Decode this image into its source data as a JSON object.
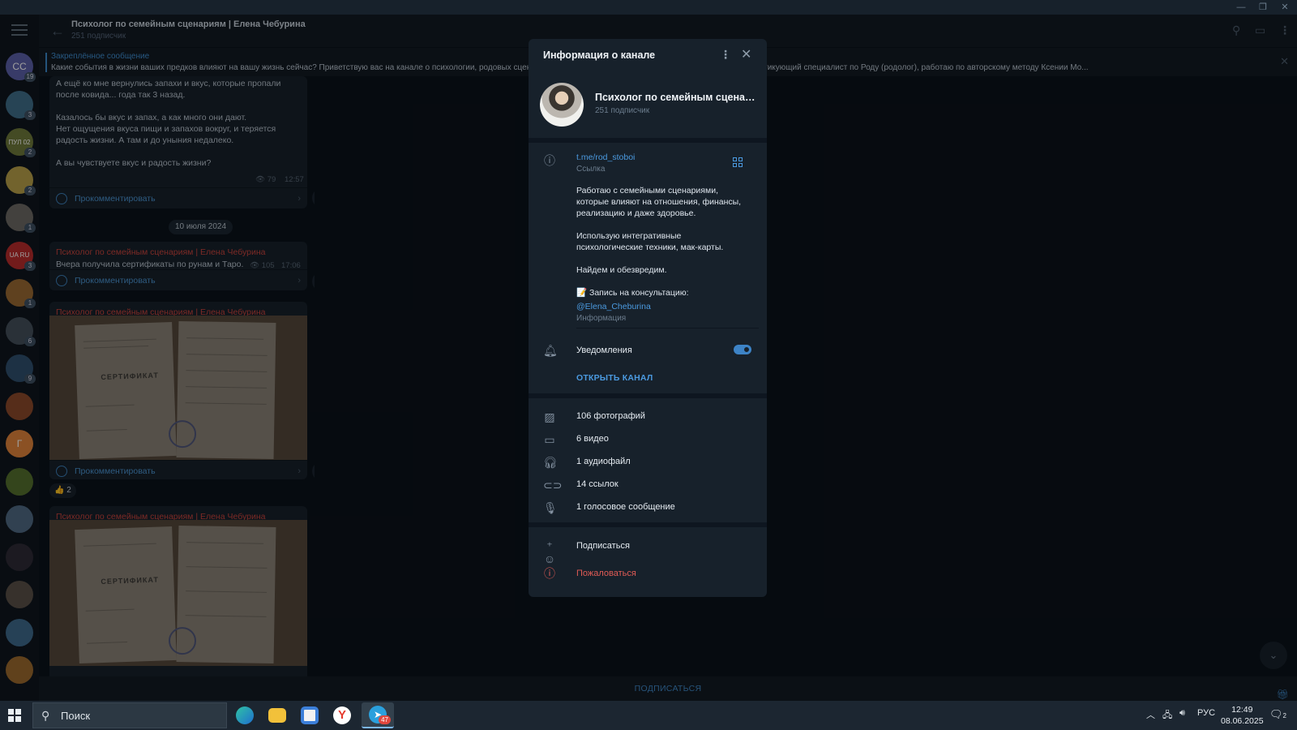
{
  "channel": {
    "title": "Психолог по семейным сценариям | Елена Чебурина",
    "subscribers": "251 подписчик"
  },
  "pinned": {
    "label": "Закреплённое сообщение",
    "text": "Какие события в жизни ваших предков влияют на вашу жизнь сейчас?  Приветствую вас на канале о психологии, родовых сценариях и исцелении рода. Меня зовут Елена Чебурина. Я практикующий специалист по Роду (родолог), работаю по авторскому методу Ксении Мо..."
  },
  "rail": {
    "avatars": [
      {
        "text": "СС",
        "color": "#5b5fa8",
        "badge": "19"
      },
      {
        "text": "",
        "color": "#3f6e8a",
        "badge": "3"
      },
      {
        "text": "ПУЛ 02",
        "color": "#6f7a3a",
        "badge": "2"
      },
      {
        "text": "",
        "color": "#b8a14a",
        "badge": "2"
      },
      {
        "text": "",
        "color": "#6d6a64",
        "badge": "1"
      },
      {
        "text": "UA RU",
        "color": "#b82c2c",
        "badge": "3"
      },
      {
        "text": "",
        "color": "#9a6a33",
        "badge": "1"
      },
      {
        "text": "",
        "color": "#44505b",
        "badge": "6"
      },
      {
        "text": "",
        "color": "#2f4f6e",
        "badge": "9"
      },
      {
        "text": "",
        "color": "#8c4a2a",
        "badge": ""
      },
      {
        "text": "Г",
        "color": "#e0843a",
        "badge": ""
      },
      {
        "text": "",
        "color": "#55702e",
        "badge": ""
      },
      {
        "text": "",
        "color": "#4f6a84",
        "badge": ""
      },
      {
        "text": "",
        "color": "#2e2a36",
        "badge": ""
      },
      {
        "text": "",
        "color": "#5a5048",
        "badge": ""
      },
      {
        "text": "",
        "color": "#3e6a8c",
        "badge": ""
      },
      {
        "text": "",
        "color": "#9b6a2e",
        "badge": ""
      }
    ]
  },
  "feed": {
    "msg1": {
      "text": "А ещё ко мне вернулись запахи и вкус, которые пропали\nпосле ковида... года так 3 назад.\n\nКазалось бы вкус и запах, а как много они дают.\nНет ощущения вкуса пищи и запахов вокруг, и теряется\nрадость жизни. А там и до уныния недалеко.\n\nА вы чувствуете вкус и радость жизни?",
      "views": "79",
      "time": "12:57"
    },
    "comment_label": "Прокомментировать",
    "date_separator": "10 июля 2024",
    "msg2": {
      "author": "Психолог по семейным сценариям | Елена Чебурина",
      "text": "Вчера получила сертификаты по рунам и Таро.",
      "views": "105",
      "time": "17:06"
    },
    "msg3": {
      "author": "Психолог по семейным сценариям | Елена Чебурина",
      "cert_title": "СЕРТИФИКАТ",
      "reaction_emoji": "👍",
      "reaction_count": "2"
    },
    "msg4": {
      "author": "Психолог по семейным сценариям | Елена Чебурина",
      "cert_title": "СЕРТИФИКАТ"
    }
  },
  "bottom": {
    "subscribe": "ПОДПИСАТЬСЯ"
  },
  "panel": {
    "title": "Информация о канале",
    "name": "Психолог по семейным сценар...",
    "subscribers": "251 подписчик",
    "link": "t.me/rod_stoboi",
    "link_label": "Ссылка",
    "description": "Работаю с семейными сценариями,\nкоторые влияют на отношения, финансы,\nреализацию и даже здоровье.\n\nИспользую интегративные\nпсихологические техники, мак-карты.\n\nНайдем и обезвредим.\n\n📝 Запись на консультацию:",
    "mention": "@Elena_Cheburina",
    "info_label": "Информация",
    "notifications": "Уведомления",
    "notifications_on": true,
    "open_channel": "ОТКРЫТЬ КАНАЛ",
    "media": {
      "photos": "106 фотографий",
      "videos": "6 видео",
      "audio": "1 аудиофайл",
      "links": "14 ссылок",
      "voice": "1 голосовое сообщение"
    },
    "subscribe": "Подписаться",
    "report": "Пожаловаться"
  },
  "taskbar": {
    "search_placeholder": "Поиск",
    "telegram_badge": "47",
    "lang": "РУС",
    "time": "12:49",
    "date": "08.06.2025",
    "notif_count": "2"
  },
  "colors": {
    "accent": "#4b9ae0",
    "danger": "#e05b55",
    "author": "#c9443d",
    "panel_bg": "#17212b"
  }
}
